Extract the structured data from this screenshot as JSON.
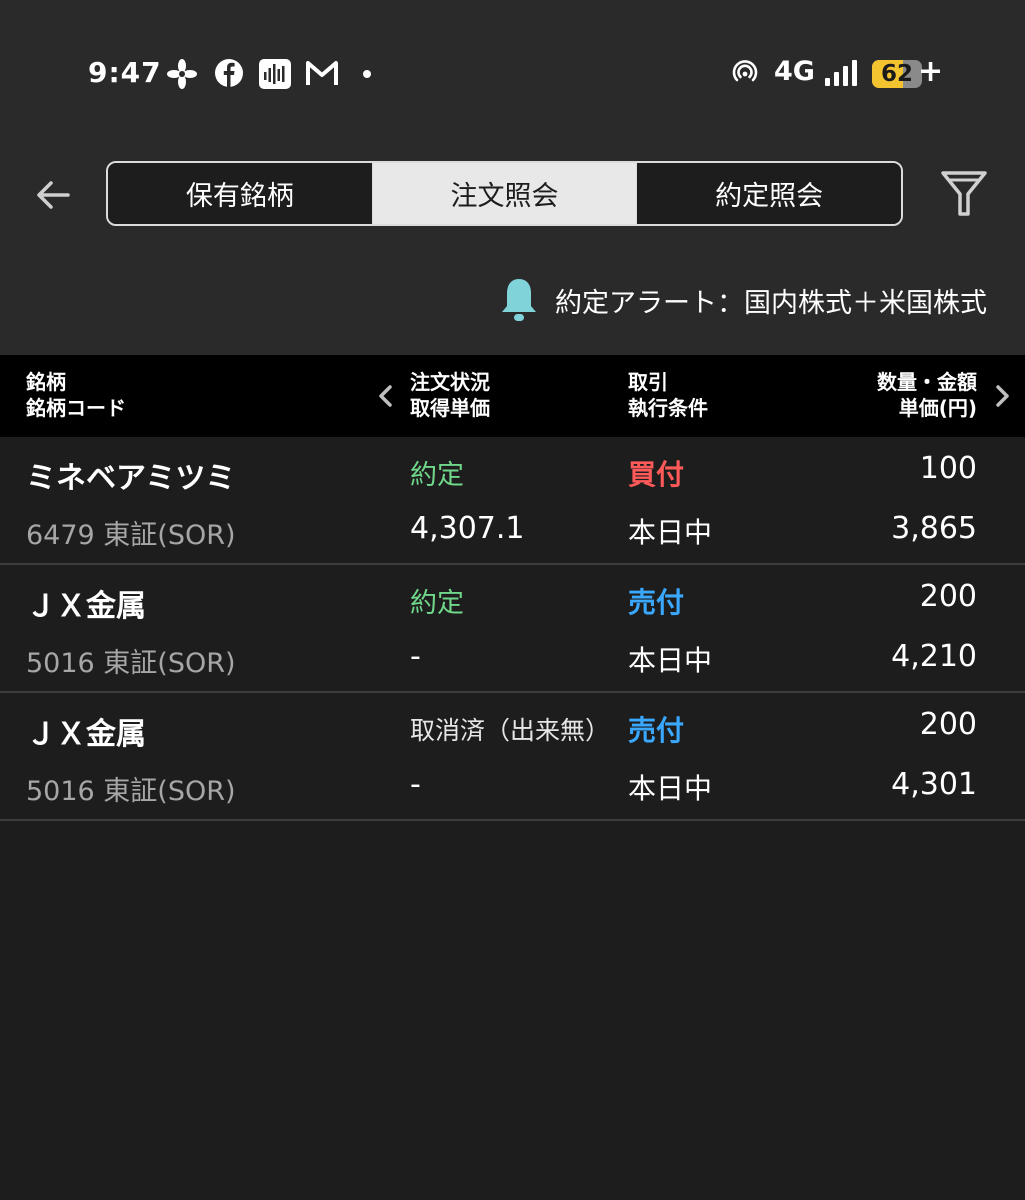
{
  "status_bar": {
    "time": "9:47",
    "network": "4G",
    "battery_level": "62",
    "battery_fraction": 0.62,
    "battery_plus": "+",
    "icons": [
      "pinwheel-icon",
      "facebook-icon",
      "voice-recorder-icon",
      "gmail-icon",
      "notification-dot",
      "hotspot-icon",
      "signal-icon"
    ]
  },
  "nav": {
    "tabs": [
      {
        "label": "保有銘柄",
        "active": false
      },
      {
        "label": "注文照会",
        "active": true
      },
      {
        "label": "約定照会",
        "active": false
      }
    ],
    "alert_text": "約定アラート：国内株式＋米国株式"
  },
  "table": {
    "headers": {
      "col1_line1": "銘柄",
      "col1_line2": "銘柄コード",
      "col2_line1": "注文状況",
      "col2_line2": "取得単価",
      "col3_line1": "取引",
      "col3_line2": "執行条件",
      "col4_line1": "数量・金額",
      "col4_line2": "単価(円)"
    },
    "rows": [
      {
        "name": "ミネベアミツミ",
        "code": "6479  東証(SOR)",
        "status": "約定",
        "price": "4,307.1",
        "side": "買付",
        "condition": "本日中",
        "quantity": "100",
        "unit_price": "3,865"
      },
      {
        "name": "ＪＸ金属",
        "code": "5016  東証(SOR)",
        "status": "約定",
        "price": "-",
        "side": "売付",
        "condition": "本日中",
        "quantity": "200",
        "unit_price": "4,210"
      },
      {
        "name": "ＪＸ金属",
        "code": "5016  東証(SOR)",
        "status": "取消済（出来無）",
        "price": "-",
        "side": "売付",
        "condition": "本日中",
        "quantity": "200",
        "unit_price": "4,301"
      }
    ]
  },
  "colors": {
    "background": "#1d1d1d",
    "executed_green": "#6fd68a",
    "buy_red": "#ff5a5a",
    "sell_blue": "#3aa8ff",
    "bell_teal": "#7fd3d9",
    "battery_yellow": "#f4c430"
  }
}
